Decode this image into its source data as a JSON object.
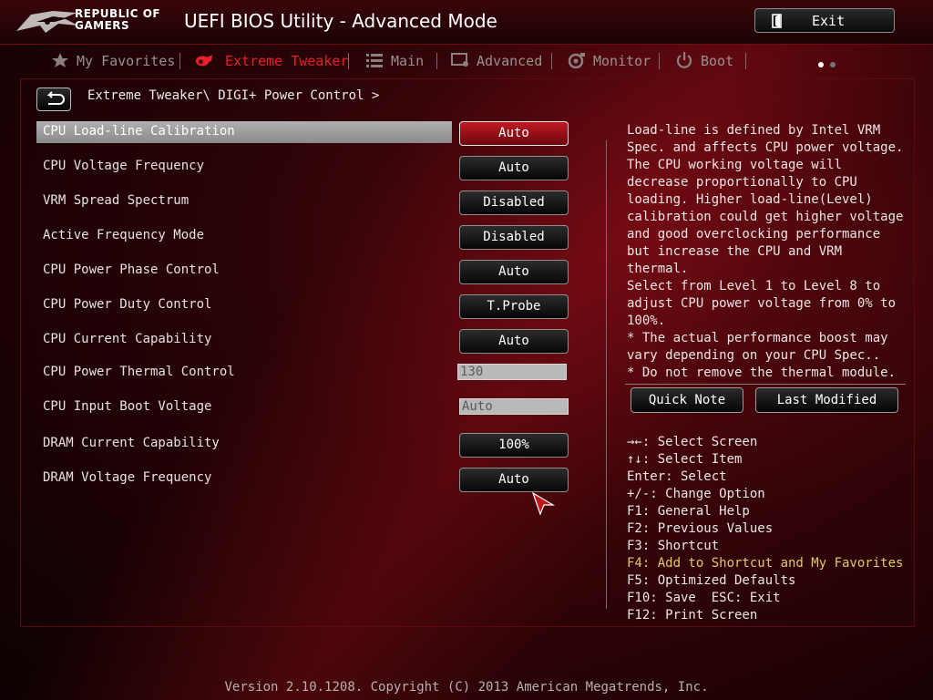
{
  "window": {
    "logo_line1": "REPUBLIC OF",
    "logo_line2": "GAMERS",
    "title": "UEFI BIOS Utility - Advanced Mode",
    "exit_label": "Exit"
  },
  "tabs": [
    {
      "label": "My Favorites",
      "icon": "star-icon",
      "active": false
    },
    {
      "label": "Extreme Tweaker",
      "icon": "tweaker-icon",
      "active": true
    },
    {
      "label": "Main",
      "icon": "list-icon",
      "active": false
    },
    {
      "label": "Advanced",
      "icon": "advanced-icon",
      "active": false
    },
    {
      "label": "Monitor",
      "icon": "monitor-icon",
      "active": false
    },
    {
      "label": "Boot",
      "icon": "power-icon",
      "active": false
    }
  ],
  "breadcrumb": "Extreme Tweaker\\ DIGI+ Power Control >",
  "settings": [
    {
      "label": "CPU Load-line Calibration",
      "value": "Auto",
      "type": "button",
      "selected": true
    },
    {
      "label": "CPU Voltage Frequency",
      "value": "Auto",
      "type": "button"
    },
    {
      "label": "VRM Spread Spectrum",
      "value": "Disabled",
      "type": "button"
    },
    {
      "label": "Active Frequency Mode",
      "value": "Disabled",
      "type": "button"
    },
    {
      "label": "CPU Power Phase Control",
      "value": "Auto",
      "type": "button"
    },
    {
      "label": "CPU Power Duty Control",
      "value": "T.Probe",
      "type": "button"
    },
    {
      "label": "CPU Current Capability",
      "value": "Auto",
      "type": "button"
    },
    {
      "label": "CPU Power Thermal Control",
      "value": "130",
      "type": "field"
    },
    {
      "label": "CPU Input Boot Voltage",
      "value": "Auto",
      "type": "field"
    },
    {
      "label": "DRAM Current Capability",
      "value": "100%",
      "type": "button"
    },
    {
      "label": "DRAM Voltage Frequency",
      "value": "Auto",
      "type": "button"
    }
  ],
  "help": {
    "description": "Load-line is defined by Intel VRM\nSpec. and affects CPU power voltage.\nThe CPU working voltage will\ndecrease proportionally to CPU\nloading. Higher load-line(Level)\ncalibration could get higher voltage\nand good overclocking performance\nbut increase the CPU and VRM thermal.\nSelect from Level 1 to Level 8 to\nadjust CPU power voltage from 0% to\n100%.",
    "note": "* The actual performance boost may\nvary depending on your CPU Spec..\n* Do not remove the thermal module.",
    "quick_note": "Quick Note",
    "last_modified": "Last Modified"
  },
  "keys": [
    {
      "text": "→←: Select Screen"
    },
    {
      "text": "↑↓: Select Item"
    },
    {
      "text": "Enter: Select"
    },
    {
      "text": "+/-: Change Option"
    },
    {
      "text": "F1: General Help"
    },
    {
      "text": "F2: Previous Values"
    },
    {
      "text": "F3: Shortcut"
    },
    {
      "text": "F4: Add to Shortcut and My Favorites",
      "highlight": true
    },
    {
      "text": "F5: Optimized Defaults"
    },
    {
      "text": "F10: Save  ESC: Exit"
    },
    {
      "text": "F12: Print Screen"
    }
  ],
  "footer": "Version 2.10.1208. Copyright (C) 2013 American Megatrends, Inc.",
  "colors": {
    "accent_red": "#e8202a",
    "shortcut_yellow": "#e9c66a",
    "dot_active": "#ffffff",
    "dot_inactive": "#777777"
  }
}
